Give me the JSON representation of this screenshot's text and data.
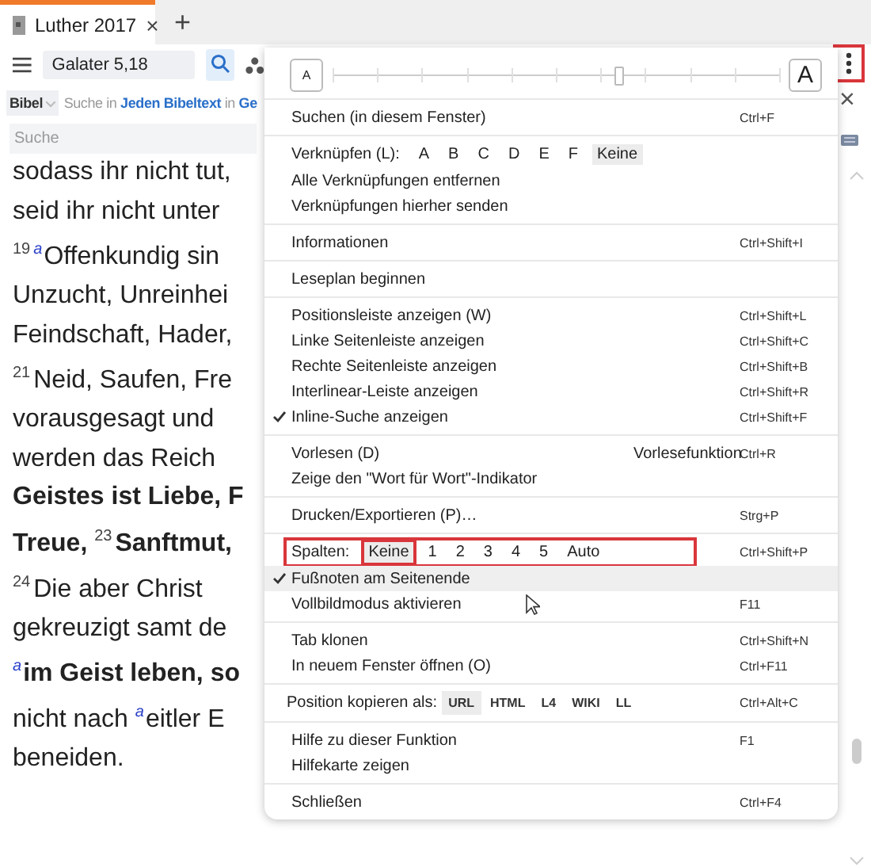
{
  "tabs": [
    {
      "label": "Luther 2017",
      "selected": true,
      "close": "×"
    }
  ],
  "new_tab": "+",
  "side_close": "×",
  "toolbar": {
    "reference": "Galater 5,18"
  },
  "search_bar": {
    "module": "Bibel",
    "prefix": "Suche in ",
    "scope": "Jeden Bibeltext",
    "middle": " in ",
    "target": "Ge",
    "placeholder": "Suche"
  },
  "text_lines": [
    [
      {
        "kind": "plain",
        "text": "sodass ihr nicht tut,"
      }
    ],
    [
      {
        "kind": "plain",
        "text": "seid ihr nicht unter"
      }
    ],
    [
      {
        "kind": "verse",
        "text": "19"
      },
      {
        "kind": "note",
        "text": "a"
      },
      {
        "kind": "plain",
        "text": "Offenkundig sin"
      }
    ],
    [
      {
        "kind": "plain",
        "text": "Unzucht, Unreinhei"
      }
    ],
    [
      {
        "kind": "plain",
        "text": "Feindschaft, Hader,"
      }
    ],
    [
      {
        "kind": "verse",
        "text": "21"
      },
      {
        "kind": "plain",
        "text": "Neid, Saufen, Fre"
      }
    ],
    [
      {
        "kind": "plain",
        "text": "vorausgesagt und"
      }
    ],
    [
      {
        "kind": "plain",
        "text": "werden das Reich"
      }
    ],
    [
      {
        "kind": "bold",
        "text": "Geistes ist Liebe, F"
      }
    ],
    [
      {
        "kind": "bold",
        "text": "Treue, "
      },
      {
        "kind": "verse",
        "text": "23"
      },
      {
        "kind": "bold",
        "text": "Sanftmut,"
      }
    ],
    [
      {
        "kind": "verse",
        "text": "24"
      },
      {
        "kind": "plain",
        "text": "Die aber Christ"
      }
    ],
    [
      {
        "kind": "plain",
        "text": "gekreuzigt samt de"
      }
    ],
    [
      {
        "kind": "note",
        "text": "a"
      },
      {
        "kind": "bold",
        "text": "im Geist leben, so"
      }
    ],
    [
      {
        "kind": "plain",
        "text": "nicht nach "
      },
      {
        "kind": "note",
        "text": "a"
      },
      {
        "kind": "plain",
        "text": "eitler E"
      }
    ],
    [
      {
        "kind": "plain",
        "text": "beneiden."
      }
    ]
  ],
  "menu_button": {
    "highlight": true
  },
  "menu": {
    "font_size": {
      "small": "A",
      "large": "A",
      "level": 0.64
    },
    "sections": [
      [
        {
          "kind": "item",
          "label": "Suchen (in diesem Fenster)",
          "shortcut": "Ctrl+F",
          "checked": false,
          "hovered": false
        }
      ],
      [
        {
          "kind": "choices",
          "label": "Verknüpfen (L):",
          "options": [
            {
              "label": "A",
              "selected": false,
              "highlight": false
            },
            {
              "label": "B",
              "selected": false,
              "highlight": false
            },
            {
              "label": "C",
              "selected": false,
              "highlight": false
            },
            {
              "label": "D",
              "selected": false,
              "highlight": false
            },
            {
              "label": "E",
              "selected": false,
              "highlight": false
            },
            {
              "label": "F",
              "selected": false,
              "highlight": false
            },
            {
              "label": "Keine",
              "selected": true,
              "highlight": false
            }
          ]
        },
        {
          "kind": "item",
          "label": "Alle Verknüpfungen entfernen",
          "checked": false,
          "hovered": false
        },
        {
          "kind": "item",
          "label": "Verknüpfungen hierher senden",
          "checked": false,
          "hovered": false
        }
      ],
      [
        {
          "kind": "item",
          "label": "Informationen",
          "shortcut": "Ctrl+Shift+I",
          "checked": false,
          "hovered": false
        }
      ],
      [
        {
          "kind": "item",
          "label": "Leseplan beginnen",
          "checked": false,
          "hovered": false
        }
      ],
      [
        {
          "kind": "item",
          "label": "Positionsleiste anzeigen (W)",
          "shortcut": "Ctrl+Shift+L",
          "checked": false,
          "hovered": false
        },
        {
          "kind": "item",
          "label": "Linke Seitenleiste anzeigen",
          "shortcut": "Ctrl+Shift+C",
          "checked": false,
          "hovered": false
        },
        {
          "kind": "item",
          "label": "Rechte Seitenleiste anzeigen",
          "shortcut": "Ctrl+Shift+B",
          "checked": false,
          "hovered": false
        },
        {
          "kind": "item",
          "label": "Interlinear-Leiste anzeigen",
          "shortcut": "Ctrl+Shift+R",
          "checked": false,
          "hovered": false
        },
        {
          "kind": "item",
          "label": "Inline-Suche anzeigen",
          "shortcut": "Ctrl+Shift+F",
          "checked": true,
          "hovered": false
        }
      ],
      [
        {
          "kind": "item",
          "label": "Vorlesen (D)",
          "extra": "Vorlesefunktion",
          "shortcut": "Ctrl+R",
          "checked": false,
          "hovered": false
        },
        {
          "kind": "item",
          "label": "Zeige den \"Wort für Wort\"-Indikator",
          "checked": false,
          "hovered": false
        }
      ],
      [
        {
          "kind": "item",
          "label": "Drucken/Exportieren (P)…",
          "shortcut": "Strg+P",
          "checked": false,
          "hovered": false
        }
      ],
      [
        {
          "kind": "choices",
          "label": "Spalten:",
          "shortcut": "Ctrl+Shift+P",
          "highlight": true,
          "options": [
            {
              "label": "Keine",
              "selected": true,
              "highlight": true
            },
            {
              "label": "1",
              "selected": false,
              "highlight": false
            },
            {
              "label": "2",
              "selected": false,
              "highlight": false
            },
            {
              "label": "3",
              "selected": false,
              "highlight": false
            },
            {
              "label": "4",
              "selected": false,
              "highlight": false
            },
            {
              "label": "5",
              "selected": false,
              "highlight": false
            },
            {
              "label": "Auto",
              "selected": false,
              "highlight": false
            }
          ]
        },
        {
          "kind": "item",
          "label": "Fußnoten am Seitenende",
          "checked": true,
          "hovered": true
        },
        {
          "kind": "item",
          "label": "Vollbildmodus aktivieren",
          "shortcut": "F11",
          "checked": false,
          "hovered": false
        }
      ],
      [
        {
          "kind": "item",
          "label": "Tab klonen",
          "shortcut": "Ctrl+Shift+N",
          "checked": false,
          "hovered": false
        },
        {
          "kind": "item",
          "label": "In neuem Fenster öffnen (O)",
          "shortcut": "Ctrl+F11",
          "checked": false,
          "hovered": false
        }
      ],
      [
        {
          "kind": "formats",
          "label": "Position kopieren als:",
          "shortcut": "Ctrl+Alt+C",
          "options": [
            {
              "label": "URL",
              "selected": true
            },
            {
              "label": "HTML",
              "selected": false
            },
            {
              "label": "L4",
              "selected": false
            },
            {
              "label": "WIKI",
              "selected": false
            },
            {
              "label": "LL",
              "selected": false
            }
          ]
        }
      ],
      [
        {
          "kind": "item",
          "label": "Hilfe zu dieser Funktion",
          "shortcut": "F1",
          "checked": false,
          "hovered": false
        },
        {
          "kind": "item",
          "label": "Hilfekarte zeigen",
          "checked": false,
          "hovered": false
        }
      ],
      [
        {
          "kind": "item",
          "label": "Schließen",
          "shortcut": "Ctrl+F4",
          "checked": false,
          "hovered": false
        }
      ]
    ]
  }
}
